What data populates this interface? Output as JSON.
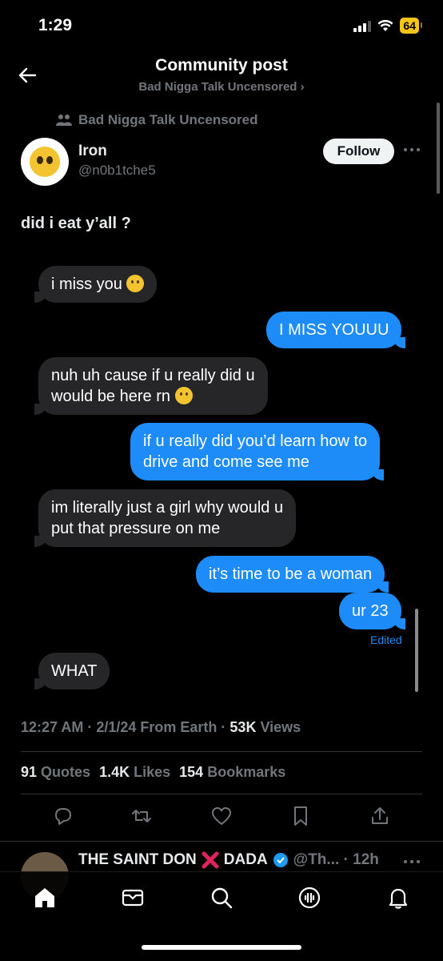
{
  "status_bar": {
    "time": "1:29",
    "battery": "64"
  },
  "header": {
    "title": "Community post",
    "subtitle": "Bad Nigga Talk Uncensored ›"
  },
  "post": {
    "community": "Bad Nigga Talk Uncensored",
    "author_name": "Iron",
    "author_handle": "@n0b1tche5",
    "follow_label": "Follow",
    "text": "did i eat y’all ?"
  },
  "messages": [
    {
      "side": "in",
      "text": "i miss you",
      "emoji": true
    },
    {
      "side": "out",
      "text": "I MISS YOUUU"
    },
    {
      "side": "in",
      "line1": "nuh uh cause if u really did u",
      "line2": "would be here rn",
      "emoji": true
    },
    {
      "side": "out",
      "line1": "if u really did you’d learn how to",
      "line2": "drive and come see me"
    },
    {
      "side": "in",
      "line1": "im literally just a girl why would u",
      "line2": "put that pressure on me"
    },
    {
      "side": "out",
      "text": "it’s time to be a woman"
    },
    {
      "side": "out",
      "text": "ur 23"
    },
    {
      "side": "in",
      "text": "WHAT"
    }
  ],
  "edited_label": "Edited",
  "meta": {
    "time": "12:27 AM · 2/1/24 From Earth · ",
    "views_num": "53K",
    "views_label": " Views"
  },
  "stats": {
    "quotes_num": "91",
    "quotes_label": "Quotes",
    "likes_num": "1.4K",
    "likes_label": "Likes",
    "bookmarks_num": "154",
    "bookmarks_label": "Bookmarks"
  },
  "next_tweet": {
    "name_part1": "THE SAINT DON",
    "name_part2": "DADA",
    "meta": "@Th... · 12h"
  },
  "tabs": [
    "home-icon",
    "messages-icon",
    "search-icon",
    "spaces-icon",
    "notifications-icon"
  ],
  "colors": {
    "accent": "#1d8cf8",
    "incoming_bubble": "#262628",
    "muted": "#71767b"
  }
}
